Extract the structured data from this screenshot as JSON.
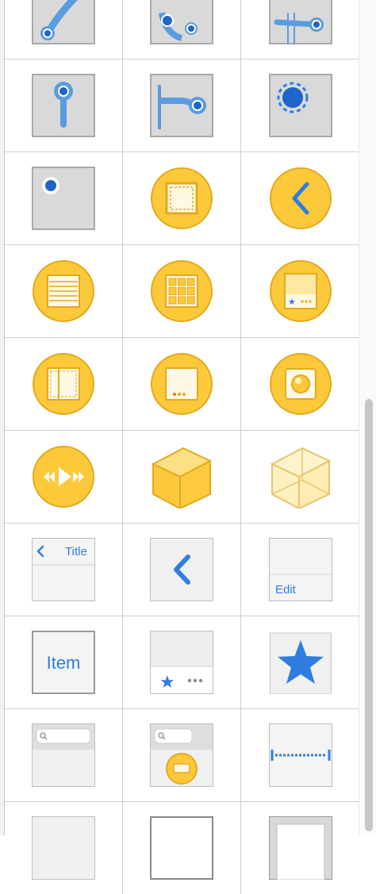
{
  "library": {
    "items": [
      {
        "name": "Pan Gesture Recognizer"
      },
      {
        "name": "Swipe Gesture Recognizer"
      },
      {
        "name": "Screen Edge Pan Gesture Recognizer"
      },
      {
        "name": "Rotation Gesture Recognizer"
      },
      {
        "name": "Long Press Gesture Recognizer"
      },
      {
        "name": "Pinch Gesture Recognizer"
      },
      {
        "name": "Tap Gesture Recognizer"
      },
      {
        "name": "View Controller"
      },
      {
        "name": "Navigation Controller"
      },
      {
        "name": "Table View Controller"
      },
      {
        "name": "Collection View Controller"
      },
      {
        "name": "Tab Bar Controller"
      },
      {
        "name": "Split View Controller"
      },
      {
        "name": "Page View Controller"
      },
      {
        "name": "GLKit View Controller"
      },
      {
        "name": "AVKit Player View Controller"
      },
      {
        "name": "Object"
      },
      {
        "name": "Storyboard Reference"
      },
      {
        "name": "Navigation Bar",
        "label": "Title"
      },
      {
        "name": "Navigation Item"
      },
      {
        "name": "Toolbar",
        "label": "Edit"
      },
      {
        "name": "Bar Button Item",
        "label": "Item"
      },
      {
        "name": "Tab Bar"
      },
      {
        "name": "Tab Bar Item"
      },
      {
        "name": "Search Bar"
      },
      {
        "name": "Search Bar and Search Display Controller"
      },
      {
        "name": "Fixed Space Bar Button Item"
      }
    ]
  },
  "colors": {
    "accent": "#2f7de1",
    "controller_fill": "#fcc93a",
    "controller_stroke": "#e3a91e",
    "tile_gray": "#d8d8d8"
  }
}
